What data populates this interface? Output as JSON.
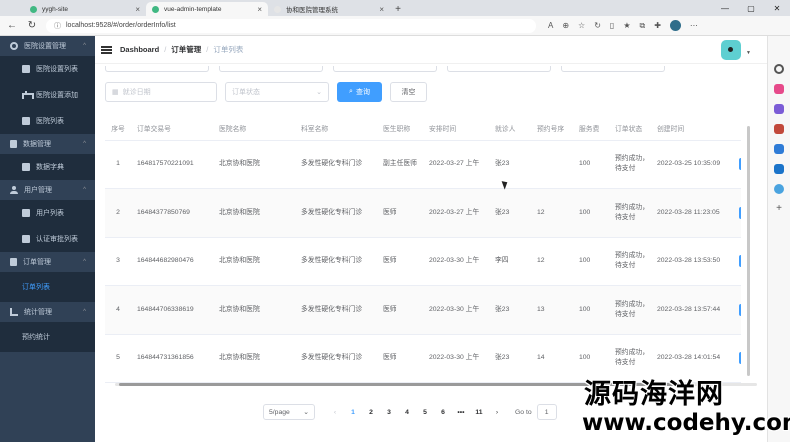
{
  "browser": {
    "tabs": [
      {
        "label": "yygh-site",
        "favicon_color": "#41b883",
        "active": false
      },
      {
        "label": "vue-admin-template",
        "favicon_color": "#41b883",
        "active": true
      },
      {
        "label": "协和医院管理系统",
        "favicon_color": "#e6e6e6",
        "active": false
      }
    ],
    "url": "localhost:9528/#/order/orderInfo/list"
  },
  "sidebar": {
    "groups": [
      {
        "label": "医院设置管理",
        "icon": "gear-icon",
        "items": [
          "医院设置列表",
          "医院设置添加",
          "医院列表"
        ]
      },
      {
        "label": "数据管理",
        "icon": "data-icon",
        "items": [
          "数据字典"
        ]
      },
      {
        "label": "用户管理",
        "icon": "user-icon",
        "items": [
          "用户列表",
          "认证审批列表"
        ]
      },
      {
        "label": "订单管理",
        "icon": "order-icon",
        "items": [
          "订单列表"
        ]
      },
      {
        "label": "统计管理",
        "icon": "chart-icon",
        "items": [
          "预约统计"
        ]
      }
    ]
  },
  "header": {
    "breadcrumb": [
      "Dashboard",
      "订单管理",
      "订单列表"
    ]
  },
  "filters": {
    "date_placeholder": "就诊日期",
    "status_placeholder": "订单状态",
    "search_label": "查询",
    "clear_label": "清空"
  },
  "table": {
    "columns": [
      "序号",
      "订单交易号",
      "医院名称",
      "科室名称",
      "医生职称",
      "安排时间",
      "就诊人",
      "预约号序",
      "服务费",
      "订单状态",
      "创建时间"
    ],
    "rows": [
      [
        "1",
        "164817570221091",
        "北京协和医院",
        "多发性硬化专科门诊",
        "副主任医师",
        "2022-03-27 上午",
        "张23",
        "",
        "100",
        "预约成功，待支付",
        "2022-03-25 10:35:09"
      ],
      [
        "2",
        "16484377850769",
        "北京协和医院",
        "多发性硬化专科门诊",
        "医师",
        "2022-03-27 上午",
        "张23",
        "12",
        "100",
        "预约成功，待支付",
        "2022-03-28 11:23:05"
      ],
      [
        "3",
        "164844682980476",
        "北京协和医院",
        "多发性硬化专科门诊",
        "医师",
        "2022-03-30 上午",
        "李四",
        "12",
        "100",
        "预约成功，待支付",
        "2022-03-28 13:53:50"
      ],
      [
        "4",
        "164844706338619",
        "北京协和医院",
        "多发性硬化专科门诊",
        "医师",
        "2022-03-30 上午",
        "张23",
        "13",
        "100",
        "预约成功，待支付",
        "2022-03-28 13:57:44"
      ],
      [
        "5",
        "164844731361856",
        "北京协和医院",
        "多发性硬化专科门诊",
        "医师",
        "2022-03-30 上午",
        "张23",
        "14",
        "100",
        "预约成功，待支付",
        "2022-03-28 14:01:54"
      ]
    ]
  },
  "pagination": {
    "page_size": "5/page",
    "pages": [
      "1",
      "2",
      "3",
      "4",
      "5",
      "6",
      "•••",
      "11"
    ],
    "active_page": "1",
    "goto_label": "Go to",
    "goto_value": "1"
  },
  "watermark": {
    "cn": "源码海洋网",
    "url": "www.codehy.com"
  },
  "colors": {
    "sidebar_bg": "#304156",
    "submenu_bg": "#1f2d3d",
    "primary": "#409eff"
  }
}
